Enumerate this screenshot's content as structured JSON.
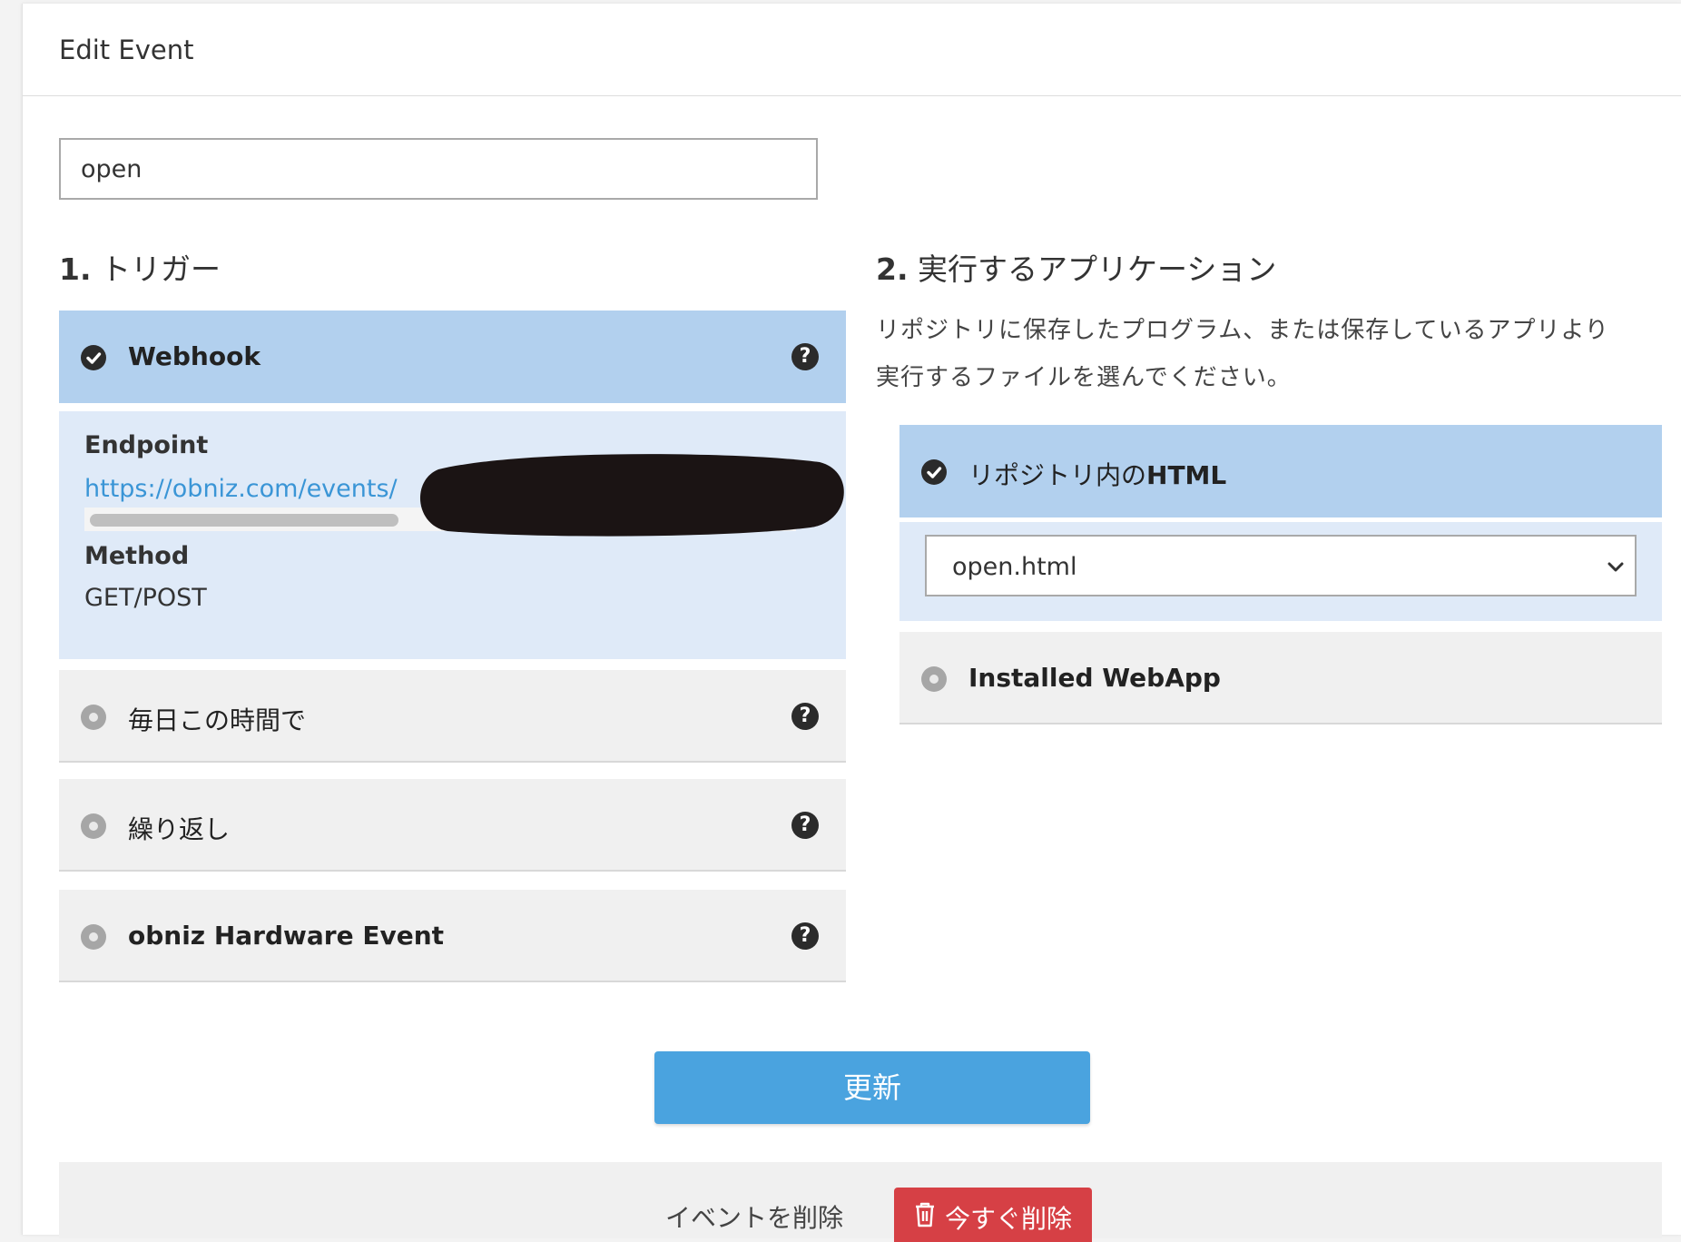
{
  "header": {
    "title": "Edit Event"
  },
  "event_name": {
    "value": "open"
  },
  "trigger": {
    "title_num": "1.",
    "title_text": "トリガー",
    "options": [
      {
        "label": "Webhook",
        "selected": true
      },
      {
        "label": "毎日この時間で",
        "selected": false
      },
      {
        "label": "繰り返し",
        "selected": false
      },
      {
        "label": "obniz Hardware Event",
        "selected": false
      }
    ],
    "webhook": {
      "endpoint_label": "Endpoint",
      "endpoint_url": "https://obniz.com/events/",
      "method_label": "Method",
      "method_value": "GET/POST"
    }
  },
  "app": {
    "title_num": "2.",
    "title_text": "実行するアプリケーション",
    "description_line1": "リポジトリに保存したプログラム、または保存しているアプリより",
    "description_line2": "実行するファイルを選んでください。",
    "options": [
      {
        "label_prefix": "リポジトリ内の",
        "label_bold": "HTML",
        "selected": true
      },
      {
        "label": "Installed WebApp",
        "selected": false
      }
    ],
    "file_select": {
      "value": "open.html"
    }
  },
  "actions": {
    "update_label": "更新",
    "delete_label": "イベントを削除",
    "delete_now_label": "今すぐ削除"
  },
  "colors": {
    "selected_header": "#b2d0ee",
    "selected_body": "#dfeaf8",
    "update_button": "#4aa3df",
    "delete_button": "#d64045",
    "link": "#3a95d6"
  }
}
